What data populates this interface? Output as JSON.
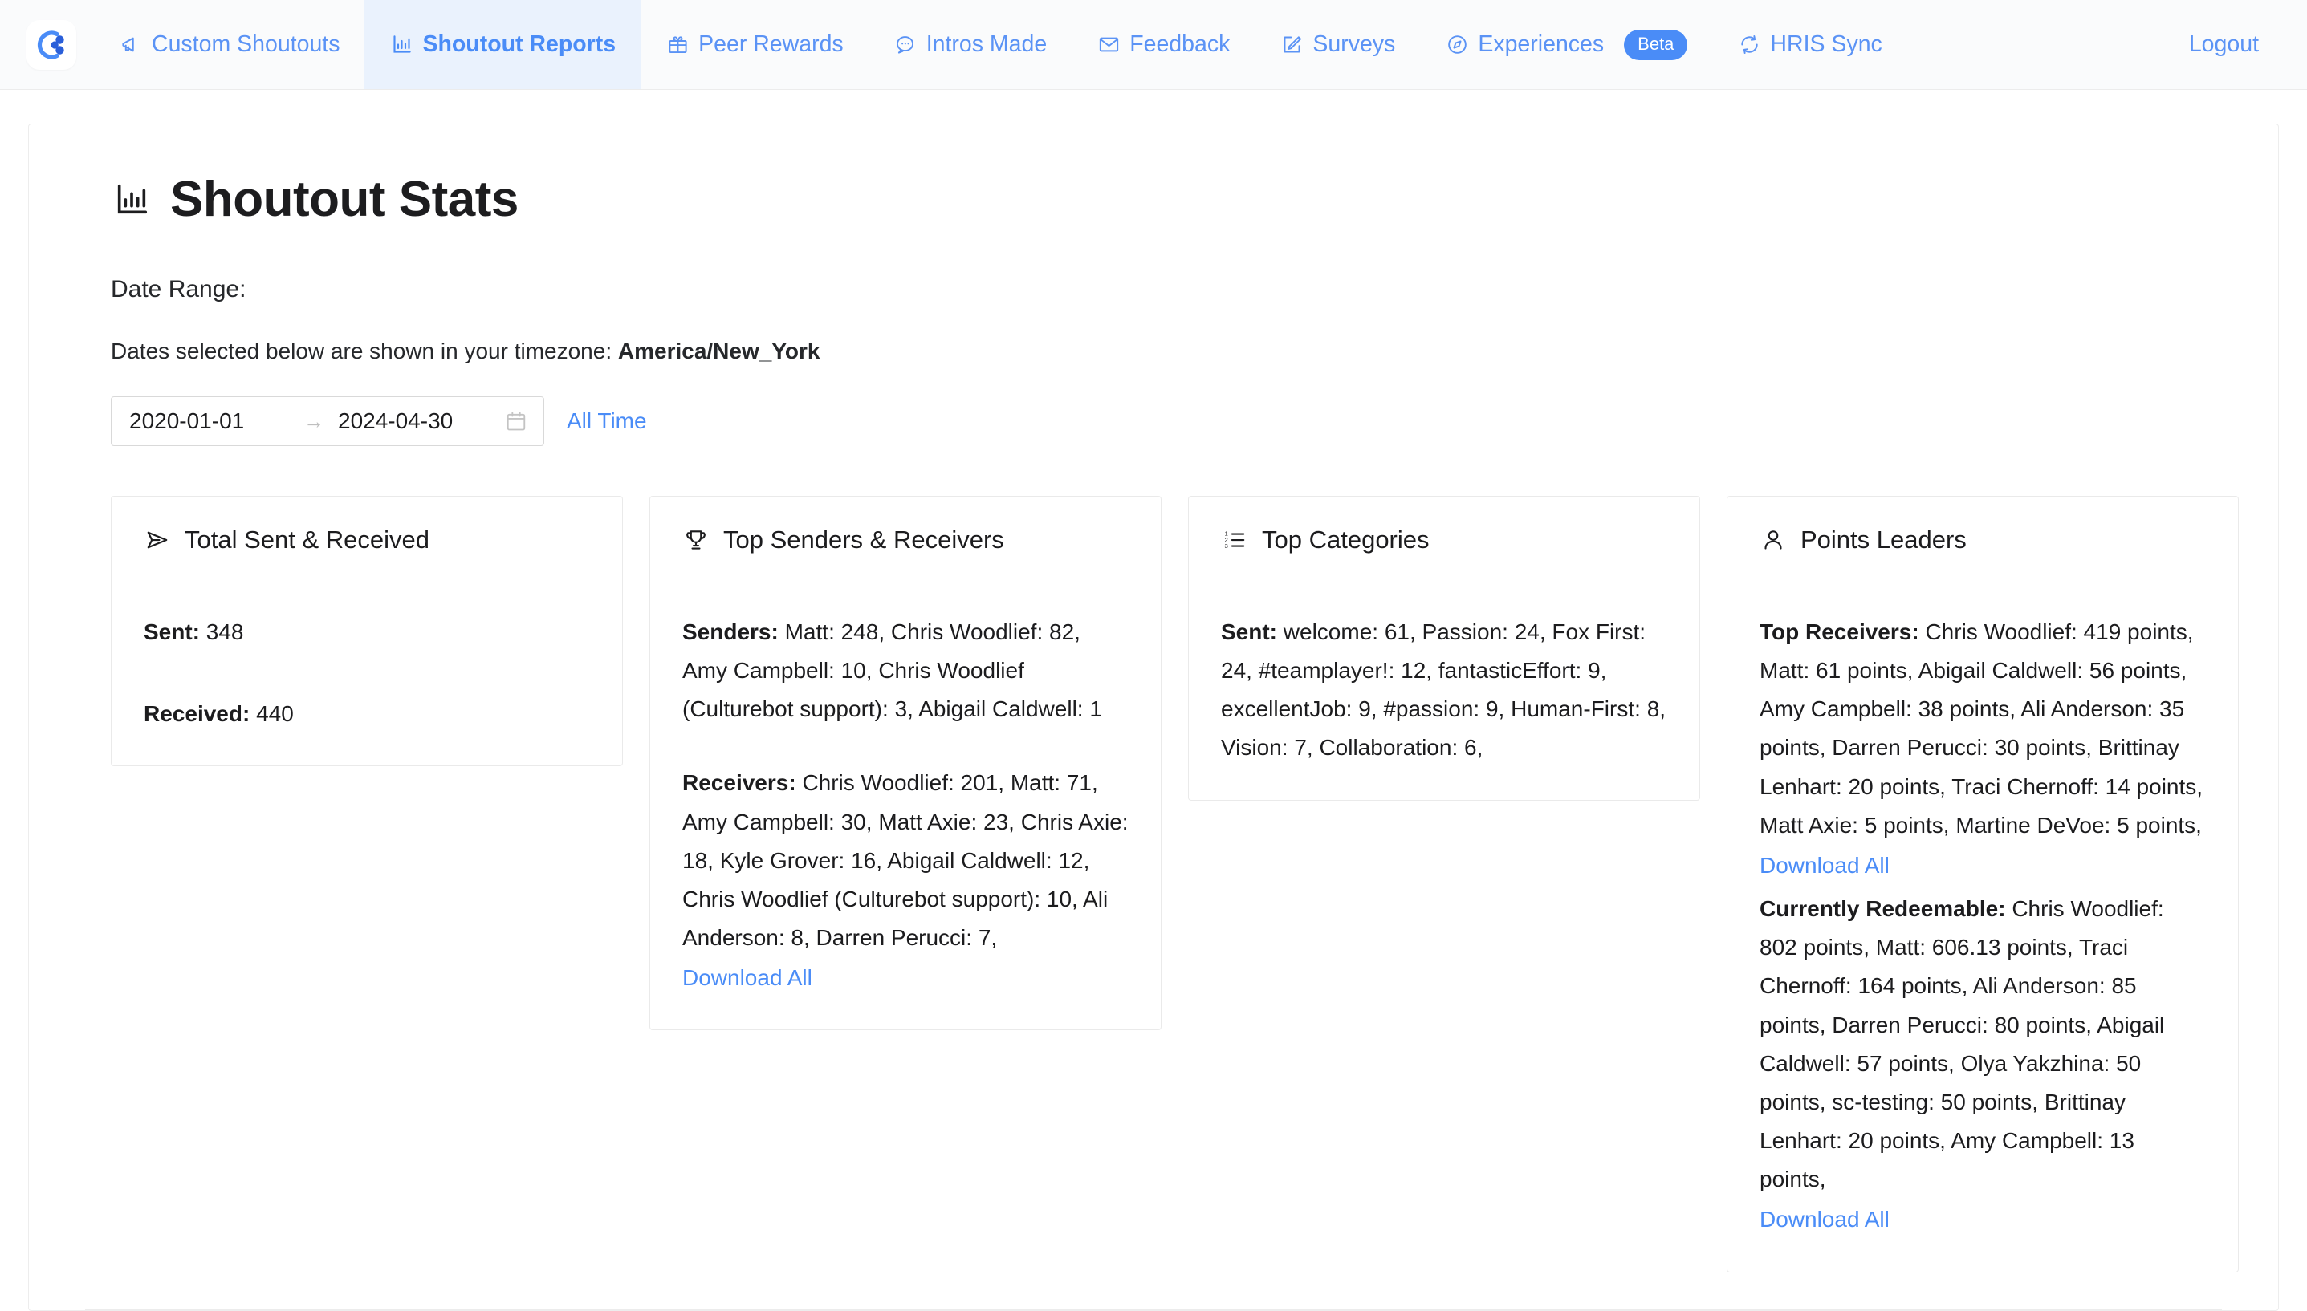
{
  "nav": {
    "logo_name": "culturebot-logo",
    "items": [
      {
        "label": "Custom Shoutouts",
        "icon": "megaphone-icon",
        "active": false,
        "badge": null
      },
      {
        "label": "Shoutout Reports",
        "icon": "bar-chart-icon",
        "active": true,
        "badge": null
      },
      {
        "label": "Peer Rewards",
        "icon": "gift-icon",
        "active": false,
        "badge": null
      },
      {
        "label": "Intros Made",
        "icon": "chat-bubble-icon",
        "active": false,
        "badge": null
      },
      {
        "label": "Feedback",
        "icon": "envelope-icon",
        "active": false,
        "badge": null
      },
      {
        "label": "Surveys",
        "icon": "edit-square-icon",
        "active": false,
        "badge": null
      },
      {
        "label": "Experiences",
        "icon": "compass-icon",
        "active": false,
        "badge": "Beta"
      },
      {
        "label": "HRIS Sync",
        "icon": "refresh-icon",
        "active": false,
        "badge": null
      }
    ],
    "logout_label": "Logout",
    "accent_color": "#4a8cf7",
    "active_tab_bg": "#eaf2fd"
  },
  "page": {
    "title": "Shoutout Stats",
    "title_icon": "bar-chart-icon",
    "date_range_label": "Date Range:",
    "timezone_prefix": "Dates selected below are shown in your timezone: ",
    "timezone_value": "America/New_York"
  },
  "date_picker": {
    "start": "2020-01-01",
    "end": "2024-04-30",
    "separator": "→",
    "calendar_icon": "calendar-icon",
    "all_time_label": "All Time"
  },
  "cards": {
    "total": {
      "title": "Total Sent & Received",
      "icon": "send-icon",
      "sent_label": "Sent:",
      "sent_value": "348",
      "received_label": "Received:",
      "received_value": "440"
    },
    "top_senders_receivers": {
      "title": "Top Senders & Receivers",
      "icon": "trophy-icon",
      "senders_label": "Senders:",
      "senders_value": "Matt: 248, Chris Woodlief: 82, Amy Campbell: 10, Chris Woodlief (Culturebot support): 3, Abigail Caldwell: 1",
      "receivers_label": "Receivers:",
      "receivers_value": "Chris Woodlief: 201, Matt: 71, Amy Campbell: 30, Matt Axie: 23, Chris Axie: 18, Kyle Grover: 16, Abigail Caldwell: 12, Chris Woodlief (Culturebot support): 10, Ali Anderson: 8, Darren Perucci: 7,",
      "download_label": "Download All"
    },
    "top_categories": {
      "title": "Top Categories",
      "icon": "ordered-list-icon",
      "sent_label": "Sent:",
      "sent_value": "welcome: 61, Passion: 24, Fox First: 24, #teamplayer!: 12, fantasticEffort: 9, excellentJob: 9, #passion: 9, Human-First: 8, Vision: 7, Collaboration: 6,"
    },
    "points_leaders": {
      "title": "Points Leaders",
      "icon": "user-icon",
      "top_receivers_label": "Top Receivers:",
      "top_receivers_value": "Chris Woodlief: 419 points, Matt: 61 points, Abigail Caldwell: 56 points, Amy Campbell: 38 points, Ali Anderson: 35 points, Darren Perucci: 30 points, Brittinay Lenhart: 20 points, Traci Chernoff: 14 points, Matt Axie: 5 points, Martine DeVoe: 5 points,",
      "top_receivers_download_label": "Download All",
      "redeemable_label": "Currently Redeemable:",
      "redeemable_value": "Chris Woodlief: 802 points, Matt: 606.13 points, Traci Chernoff: 164 points, Ali Anderson: 85 points, Darren Perucci: 80 points, Abigail Caldwell: 57 points, Olya Yakzhina: 50 points, sc-testing: 50 points, Brittinay Lenhart: 20 points, Amy Campbell: 13 points,",
      "redeemable_download_label": "Download All"
    }
  },
  "chart_data": {
    "type": "table",
    "title": "Shoutout Stats",
    "totals": {
      "sent": 348,
      "received": 440
    },
    "top_senders": [
      {
        "name": "Matt",
        "value": 248
      },
      {
        "name": "Chris Woodlief",
        "value": 82
      },
      {
        "name": "Amy Campbell",
        "value": 10
      },
      {
        "name": "Chris Woodlief (Culturebot support)",
        "value": 3
      },
      {
        "name": "Abigail Caldwell",
        "value": 1
      }
    ],
    "top_receivers": [
      {
        "name": "Chris Woodlief",
        "value": 201
      },
      {
        "name": "Matt",
        "value": 71
      },
      {
        "name": "Amy Campbell",
        "value": 30
      },
      {
        "name": "Matt Axie",
        "value": 23
      },
      {
        "name": "Chris Axie",
        "value": 18
      },
      {
        "name": "Kyle Grover",
        "value": 16
      },
      {
        "name": "Abigail Caldwell",
        "value": 12
      },
      {
        "name": "Chris Woodlief (Culturebot support)",
        "value": 10
      },
      {
        "name": "Ali Anderson",
        "value": 8
      },
      {
        "name": "Darren Perucci",
        "value": 7
      }
    ],
    "top_categories_sent": [
      {
        "name": "welcome",
        "value": 61
      },
      {
        "name": "Passion",
        "value": 24
      },
      {
        "name": "Fox First",
        "value": 24
      },
      {
        "name": "#teamplayer!",
        "value": 12
      },
      {
        "name": "fantasticEffort",
        "value": 9
      },
      {
        "name": "excellentJob",
        "value": 9
      },
      {
        "name": "#passion",
        "value": 9
      },
      {
        "name": "Human-First",
        "value": 8
      },
      {
        "name": "Vision",
        "value": 7
      },
      {
        "name": "Collaboration",
        "value": 6
      }
    ],
    "points_top_receivers": [
      {
        "name": "Chris Woodlief",
        "points": 419
      },
      {
        "name": "Matt",
        "points": 61
      },
      {
        "name": "Abigail Caldwell",
        "points": 56
      },
      {
        "name": "Amy Campbell",
        "points": 38
      },
      {
        "name": "Ali Anderson",
        "points": 35
      },
      {
        "name": "Darren Perucci",
        "points": 30
      },
      {
        "name": "Brittinay Lenhart",
        "points": 20
      },
      {
        "name": "Traci Chernoff",
        "points": 14
      },
      {
        "name": "Matt Axie",
        "points": 5
      },
      {
        "name": "Martine DeVoe",
        "points": 5
      }
    ],
    "points_currently_redeemable": [
      {
        "name": "Chris Woodlief",
        "points": 802
      },
      {
        "name": "Matt",
        "points": 606.13
      },
      {
        "name": "Traci Chernoff",
        "points": 164
      },
      {
        "name": "Ali Anderson",
        "points": 85
      },
      {
        "name": "Darren Perucci",
        "points": 80
      },
      {
        "name": "Abigail Caldwell",
        "points": 57
      },
      {
        "name": "Olya Yakzhina",
        "points": 50
      },
      {
        "name": "sc-testing",
        "points": 50
      },
      {
        "name": "Brittinay Lenhart",
        "points": 20
      },
      {
        "name": "Amy Campbell",
        "points": 13
      }
    ],
    "date_range": {
      "start": "2020-01-01",
      "end": "2024-04-30"
    }
  }
}
